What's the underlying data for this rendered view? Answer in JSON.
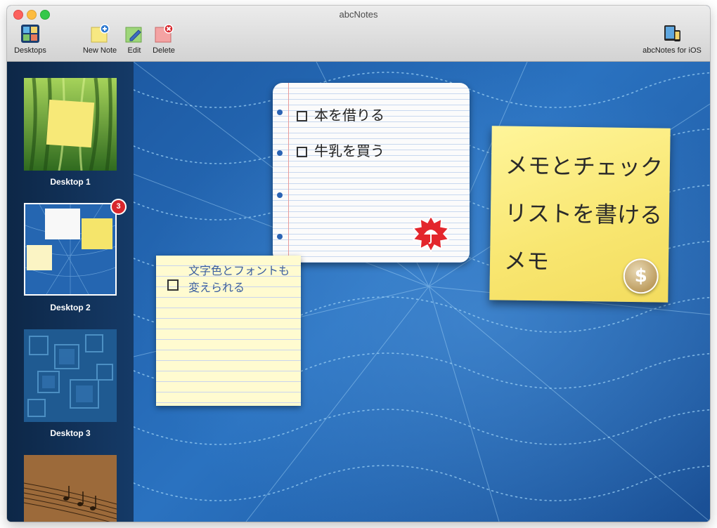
{
  "window": {
    "title": "abcNotes"
  },
  "toolbar": {
    "desktops": {
      "label": "Desktops",
      "icon": "desktops-icon"
    },
    "new_note": {
      "label": "New Note",
      "icon": "new-note-icon"
    },
    "edit": {
      "label": "Edit",
      "icon": "edit-pencil-icon"
    },
    "delete": {
      "label": "Delete",
      "icon": "delete-note-icon"
    },
    "ios": {
      "label": "abcNotes for iOS",
      "icon": "ios-devices-icon"
    }
  },
  "sidebar": {
    "desktops": [
      {
        "label": "Desktop 1",
        "selected": false
      },
      {
        "label": "Desktop 2",
        "selected": true,
        "badge": "3"
      },
      {
        "label": "Desktop 3",
        "selected": false
      },
      {
        "label": "",
        "selected": false
      }
    ]
  },
  "notes": {
    "checklist": {
      "items": [
        {
          "text": "本を借りる",
          "checked": false
        },
        {
          "text": "牛乳を買う",
          "checked": false
        }
      ]
    },
    "yellow": {
      "text": "文字色とフォントも変えられる",
      "checked": false
    },
    "postit": {
      "text": "メモとチェックリストを書けるメモ",
      "coin": "$"
    }
  },
  "colors": {
    "accent_blue": "#1d5aa3",
    "postit_yellow": "#f8e670",
    "badge_red": "#d8262c"
  }
}
